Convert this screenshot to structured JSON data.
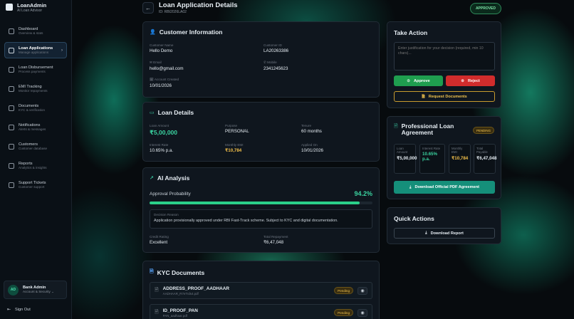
{
  "sidebar": {
    "brand_name": "LoanAdmin",
    "brand_sub": "AI Loan Advisor",
    "items": [
      {
        "label": "Dashboard",
        "desc": "Overview & stats"
      },
      {
        "label": "Loan Applications",
        "desc": "Manage applications"
      },
      {
        "label": "Loan Disbursement",
        "desc": "Process payments"
      },
      {
        "label": "EMI Tracking",
        "desc": "Monitor repayments"
      },
      {
        "label": "Documents",
        "desc": "KYC & verification"
      },
      {
        "label": "Notifications",
        "desc": "Alerts & messages"
      },
      {
        "label": "Customers",
        "desc": "Customer database"
      },
      {
        "label": "Reports",
        "desc": "Analytics & insights"
      },
      {
        "label": "Support Tickets",
        "desc": "Customer support"
      }
    ],
    "active_chevron": "›",
    "user": {
      "initials": "AD",
      "name": "Bank Admin",
      "role": "Account & Security ⌄"
    },
    "signout": "Sign Out"
  },
  "header": {
    "back": "←",
    "title": "Loan Application Details",
    "subtitle": "ID: RBI2026LA02",
    "status": "APPROVED"
  },
  "customer": {
    "title": "Customer Information",
    "name_label": "Customer Name",
    "name": "Hello Demo",
    "id_label": "Customer ID",
    "id": "LA20263386",
    "email_label": "✉ Email",
    "email": "hello@gmail.com",
    "mobile_label": "✆ Mobile",
    "mobile": "2341245623",
    "created_label": "🗓 Account Created",
    "created": "10/01/2026"
  },
  "loan": {
    "title": "Loan Details",
    "amount_label": "Loan Amount",
    "amount": "₹5,00,000",
    "purpose_label": "Purpose",
    "purpose": "PERSONAL",
    "tenure_label": "Tenure",
    "tenure": "60 months",
    "rate_label": "Interest Rate",
    "rate": "10.65% p.a.",
    "emi_label": "Monthly EMI",
    "emi": "₹10,784",
    "applied_label": "Applied On",
    "applied": "10/01/2026"
  },
  "ai": {
    "title": "AI Analysis",
    "prob_label": "Approval Probability",
    "prob_value": "94.2%",
    "prob_fraction": 0.942,
    "reason_label": "Decision Reason",
    "reason": "Application provisionally approved under RBI Fast-Track scheme. Subject to KYC and digital documentation.",
    "credit_label": "Credit Rating",
    "credit": "Excellent",
    "repay_label": "Total Repayment",
    "repay": "₹6,47,048"
  },
  "kyc": {
    "title": "KYC Documents",
    "docs": [
      {
        "name": "ADDRESS_PROOF_AADHAAR",
        "file": "AADHAAR_R7eTrds4.pdf",
        "status": "Pending"
      },
      {
        "name": "ID_PROOF_PAN",
        "file": "PAN_aadhaar.pdf",
        "status": "Pending"
      }
    ]
  },
  "action": {
    "title": "Take Action",
    "placeholder": "Enter justification for your decision (required, min 10 chars)...",
    "approve": "Approve",
    "reject": "Reject",
    "request": "Request Documents"
  },
  "agreement": {
    "title": "Professional Loan Agreement",
    "status": "PENDING",
    "stats": [
      {
        "label": "Loan Amount",
        "value": "₹5,00,000"
      },
      {
        "label": "Interest Rate",
        "value": "10.65% p.a."
      },
      {
        "label": "Monthly EMI",
        "value": "₹10,784"
      },
      {
        "label": "Total Payable",
        "value": "₹6,47,048"
      }
    ],
    "download": "Download Official PDF Agreement"
  },
  "quick": {
    "title": "Quick Actions",
    "report": "Download Report"
  },
  "colors": {
    "accent": "#3ad29f",
    "approve": "#1f9e4f",
    "reject": "#d12c2c",
    "warning": "#f0c24e"
  }
}
